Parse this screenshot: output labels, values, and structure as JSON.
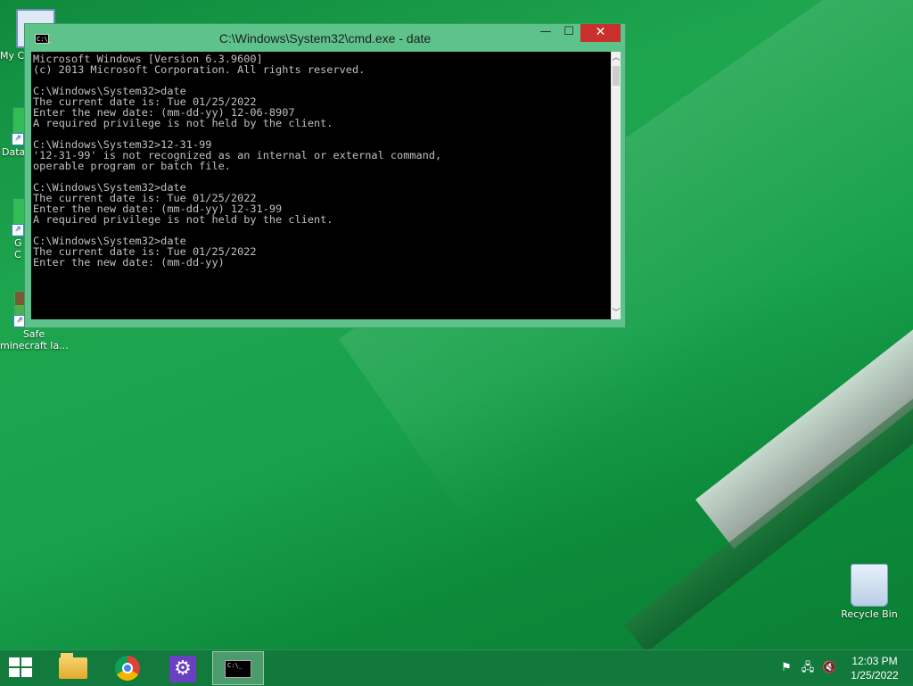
{
  "desktop": {
    "icons": [
      {
        "label": "My C",
        "icon": "computer-icon"
      },
      {
        "label": "Data",
        "icon": "shortcut-icon"
      },
      {
        "label": "G\nC",
        "icon": "shortcut-icon"
      },
      {
        "label": "Safe\nminecraft la...",
        "icon": "minecraft-shortcut-icon"
      },
      {
        "label": "Recycle Bin",
        "icon": "recycle-bin-icon"
      }
    ]
  },
  "cmd_window": {
    "title": "C:\\Windows\\System32\\cmd.exe - date",
    "sys_icon_text": "C:\\_",
    "minimize_glyph": "—",
    "maximize_glyph": "☐",
    "close_glyph": "✕",
    "console_lines": [
      "Microsoft Windows [Version 6.3.9600]",
      "(c) 2013 Microsoft Corporation. All rights reserved.",
      "",
      "C:\\Windows\\System32>date",
      "The current date is: Tue 01/25/2022",
      "Enter the new date: (mm-dd-yy) 12-06-8907",
      "A required privilege is not held by the client.",
      "",
      "C:\\Windows\\System32>12-31-99",
      "'12-31-99' is not recognized as an internal or external command,",
      "operable program or batch file.",
      "",
      "C:\\Windows\\System32>date",
      "The current date is: Tue 01/25/2022",
      "Enter the new date: (mm-dd-yy) 12-31-99",
      "A required privilege is not held by the client.",
      "",
      "C:\\Windows\\System32>date",
      "The current date is: Tue 01/25/2022",
      "Enter the new date: (mm-dd-yy)"
    ],
    "scroll_up_glyph": "︿",
    "scroll_down_glyph": "﹀"
  },
  "taskbar": {
    "pinned": [
      {
        "name": "file-explorer",
        "icon": "folder-icon"
      },
      {
        "name": "chrome",
        "icon": "chrome-icon"
      },
      {
        "name": "settings",
        "icon": "gear-icon"
      },
      {
        "name": "command-prompt",
        "icon": "cmd-icon",
        "active": true
      }
    ],
    "cmd_icon_text": "C:\\_",
    "settings_glyph": "⚙",
    "tray": {
      "flag_glyph": "⚑",
      "network_glyph": "🖧",
      "volume_glyph": "🔇"
    },
    "clock": {
      "time": "12:03 PM",
      "date": "1/25/2022"
    }
  }
}
